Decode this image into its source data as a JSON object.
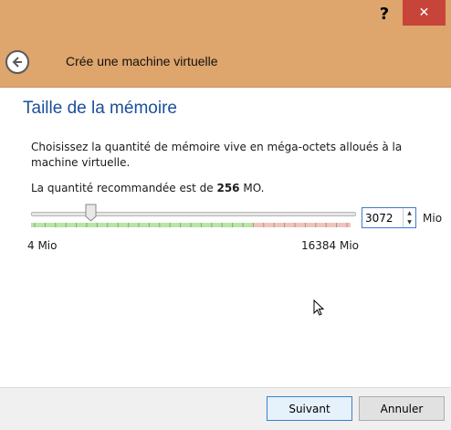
{
  "window": {
    "help_label": "?",
    "close_label": "✕",
    "title": "Crée une machine virtuelle"
  },
  "page": {
    "heading": "Taille de la mémoire",
    "description": "Choisissez la quantité de mémoire vive en méga-octets alloués à la machine virtuelle.",
    "recommend_prefix": "La quantité recommandée est de ",
    "recommend_value": "256",
    "recommend_suffix": " MO."
  },
  "memory": {
    "min_label": "4 Mio",
    "max_label": "16384 Mio",
    "value": "3072",
    "unit": "Mio",
    "min": 4,
    "max": 16384,
    "current": 3072
  },
  "buttons": {
    "next": "Suivant",
    "cancel": "Annuler"
  },
  "colors": {
    "titlebar": "#dea56c",
    "heading": "#1b4e9b",
    "close": "#c7443a",
    "safe_zone": "#b8e6a5",
    "danger_zone": "#f1c4bb"
  }
}
